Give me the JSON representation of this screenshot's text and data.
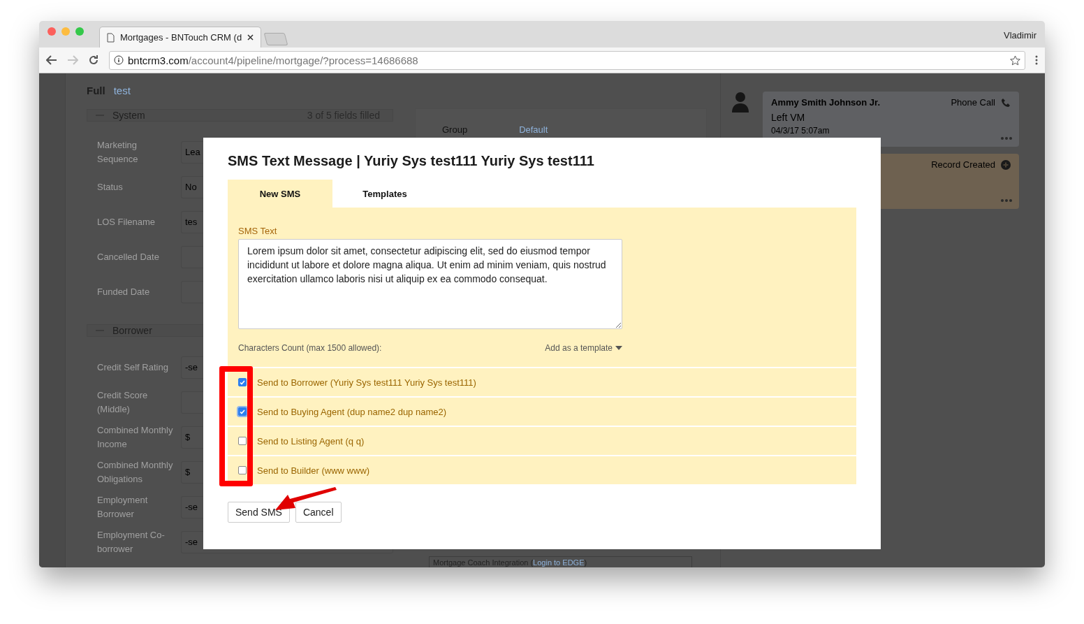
{
  "browser": {
    "tab_title": "Mortgages - BNTouch CRM (d",
    "user": "Vladimir",
    "url_host": "bntcrm3.com",
    "url_path": "/account4/pipeline/mortgage/?process=14686688"
  },
  "page": {
    "view_label": "Full",
    "view_link": "test",
    "sections": [
      {
        "title": "System",
        "summary": "3 of 5 fields filled",
        "fields": [
          {
            "label": "Marketing Sequence",
            "value": "Lea"
          },
          {
            "label": "Status",
            "value": "No"
          },
          {
            "label": "LOS Filename",
            "value": "tes"
          },
          {
            "label": "Cancelled Date"
          },
          {
            "label": "Funded Date"
          }
        ]
      },
      {
        "title": "Borrower",
        "fields": [
          {
            "label": "Credit Self Rating",
            "value": "-se"
          },
          {
            "label": "Credit Score (Middle)"
          },
          {
            "label": "Combined Monthly Income",
            "value": "$"
          },
          {
            "label": "Combined Monthly Obligations",
            "value": "$"
          },
          {
            "label": "Employment Borrower",
            "value": "-se"
          },
          {
            "label": "Employment Co-borrower",
            "value": "-se"
          }
        ]
      }
    ],
    "group": {
      "label": "Group",
      "value": "Default"
    },
    "integration": {
      "text": "Mortgage Coach Integration (",
      "link": "Login to EDGE",
      "end": ")"
    },
    "activity": [
      {
        "kind": "call",
        "author": "Ammy Smith Johnson Jr.",
        "type": "Phone Call",
        "note": "Left VM",
        "time": "04/3/17 5:07am"
      },
      {
        "kind": "record",
        "type": "Record Created"
      }
    ]
  },
  "modal": {
    "title": "SMS Text Message | Yuriy Sys test111 Yuriy Sys test111",
    "tabs": [
      {
        "label": "New SMS",
        "selected": true
      },
      {
        "label": "Templates",
        "selected": false
      }
    ],
    "sms_label": "SMS Text",
    "message": "Lorem ipsum dolor sit amet, consectetur adipiscing elit, sed do eiusmod tempor incididunt ut labore et dolore magna aliqua. Ut enim ad minim veniam, quis nostrud exercitation ullamco laboris nisi ut aliquip ex ea commodo consequat.",
    "char_count": "Characters Count (max 1500 allowed):",
    "add_template": "Add as a template",
    "recipients": [
      {
        "label": "Send to Borrower (Yuriy Sys test111 Yuriy Sys test111)",
        "checked": true,
        "focused": false
      },
      {
        "label": "Send to Buying Agent (dup name2 dup name2)",
        "checked": true,
        "focused": true
      },
      {
        "label": "Send to Listing Agent (q q)",
        "checked": false,
        "focused": false
      },
      {
        "label": "Send to Builder (www www)",
        "checked": false,
        "focused": false
      }
    ],
    "buttons": [
      "Send SMS",
      "Cancel"
    ]
  }
}
